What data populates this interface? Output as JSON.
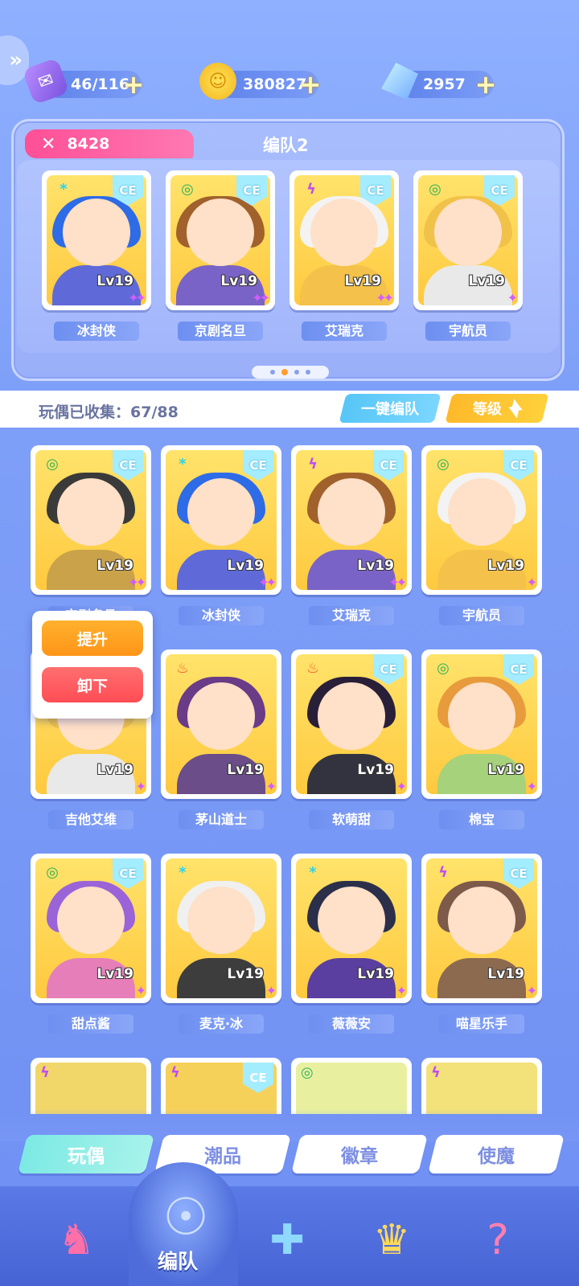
{
  "resources": {
    "stamina": {
      "value": "46/116",
      "icon": "ticket-icon"
    },
    "coins": {
      "value": "380827",
      "icon": "coin-icon"
    },
    "gems": {
      "value": "2957",
      "icon": "crystal-icon"
    },
    "plus": "+"
  },
  "team": {
    "power": "8428",
    "name": "编队2",
    "members": [
      {
        "name": "冰封侠",
        "level": "Lv19",
        "element": "*",
        "ce": "CE",
        "stars": "✦✦"
      },
      {
        "name": "京剧名旦",
        "level": "Lv19",
        "element": "◎",
        "ce": "CE",
        "stars": "✦✦"
      },
      {
        "name": "艾瑞克",
        "level": "Lv19",
        "element": "ϟ",
        "ce": "CE",
        "stars": "✦✦"
      },
      {
        "name": "宇航员",
        "level": "Lv19",
        "element": "◎",
        "ce": "CE",
        "stars": "✦"
      }
    ],
    "page_count": 4,
    "current_page": 2
  },
  "collection": {
    "text": "玩偶已收集：67/88",
    "one_key_label": "一键编队",
    "sort_label": "等级"
  },
  "popup": {
    "upgrade_label": "提升",
    "unload_label": "卸下"
  },
  "dolls": [
    {
      "name": "京剧名旦",
      "level": "Lv19",
      "element": "◎",
      "ce": "CE",
      "stars": "✦✦"
    },
    {
      "name": "冰封侠",
      "level": "Lv19",
      "element": "*",
      "ce": "CE",
      "stars": "✦✦"
    },
    {
      "name": "艾瑞克",
      "level": "Lv19",
      "element": "ϟ",
      "ce": "CE",
      "stars": "✦✦"
    },
    {
      "name": "宇航员",
      "level": "Lv19",
      "element": "◎",
      "ce": "CE",
      "stars": "✦"
    },
    {
      "name": "吉他艾维",
      "level": "Lv19",
      "element": "",
      "ce": "",
      "stars": "✦"
    },
    {
      "name": "茅山道士",
      "level": "Lv19",
      "element": "♨",
      "ce": "",
      "stars": "✦"
    },
    {
      "name": "软萌甜",
      "level": "Lv19",
      "element": "♨",
      "ce": "CE",
      "stars": "✦"
    },
    {
      "name": "棉宝",
      "level": "Lv19",
      "element": "◎",
      "ce": "CE",
      "stars": "✦"
    },
    {
      "name": "甜点酱",
      "level": "Lv19",
      "element": "◎",
      "ce": "CE",
      "stars": "✦"
    },
    {
      "name": "麦克·冰",
      "level": "Lv19",
      "element": "*",
      "ce": "",
      "stars": "✦"
    },
    {
      "name": "薇薇安",
      "level": "Lv19",
      "element": "*",
      "ce": "",
      "stars": "✦"
    },
    {
      "name": "喵星乐手",
      "level": "Lv19",
      "element": "ϟ",
      "ce": "CE",
      "stars": "✦"
    }
  ],
  "partial_row": [
    {
      "element": "ϟ",
      "ce": ""
    },
    {
      "element": "ϟ",
      "ce": "CE"
    },
    {
      "element": "◎",
      "ce": ""
    },
    {
      "element": "ϟ",
      "ce": ""
    }
  ],
  "category_tabs": [
    "玩偶",
    "潮品",
    "徽章",
    "使魔"
  ],
  "active_category": "玩偶",
  "nav": {
    "center_label": "编队",
    "items": [
      "character-icon",
      "team-icon",
      "puzzle-icon",
      "trophy-icon",
      "shop-icon"
    ]
  },
  "colors": {
    "power_tab": "#ff4f96",
    "one_key": "#57c6f6",
    "sort": "#ffb92a",
    "upgrade": "#ff9f1a",
    "unload": "#ff5a5a",
    "active_tab": "#7de9e4"
  }
}
